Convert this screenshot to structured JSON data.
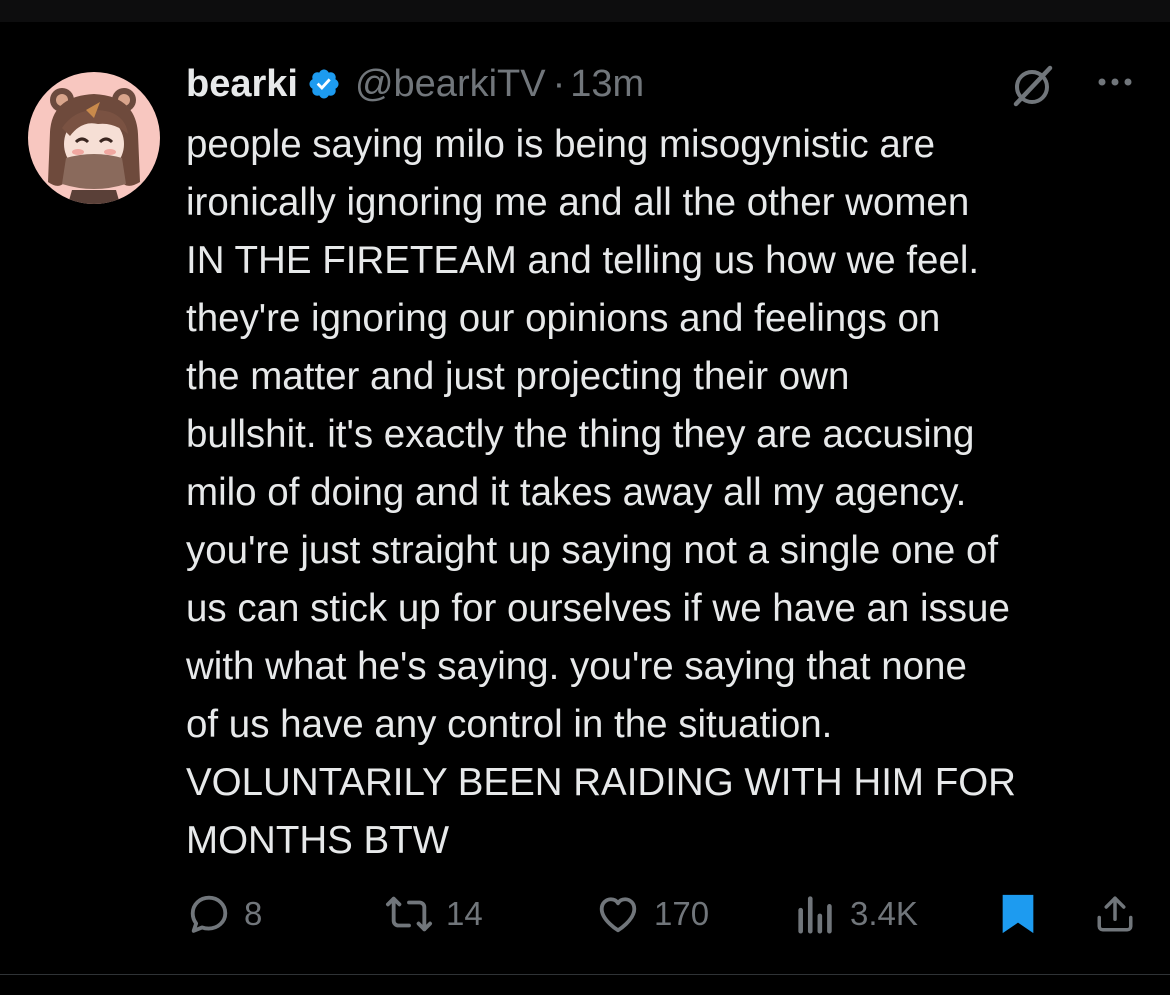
{
  "tweet": {
    "display_name": "bearki",
    "handle": "@bearkiTV",
    "separator": "·",
    "time": "13m",
    "verified": true,
    "text_lines": [
      "people saying milo is being misogynistic are",
      "ironically ignoring me and all the other women",
      "IN THE FIRETEAM and telling us how we feel.",
      "they're ignoring our opinions and feelings on",
      "the matter and just projecting their own",
      "bullshit. it's exactly the thing they are accusing",
      "milo of doing and it takes away all my agency.",
      "you're just straight up saying not a single one of",
      "us can stick up for ourselves if we have an issue",
      "with what he's saying. you're saying that none",
      "of us have any control in the situation.",
      "VOLUNTARILY BEEN RAIDING WITH HIM FOR",
      "MONTHS BTW"
    ]
  },
  "actions": {
    "replies": "8",
    "reposts": "14",
    "likes": "170",
    "views": "3.4K"
  },
  "icons": {
    "avatar": "avatar-image",
    "verified": "verified-badge-icon",
    "grok": "grok-icon",
    "more": "more-icon",
    "reply": "reply-icon",
    "repost": "repost-icon",
    "like": "heart-icon",
    "views": "views-icon",
    "bookmark": "bookmark-icon",
    "share": "share-icon"
  },
  "colors": {
    "background": "#000000",
    "text": "#e7e9ea",
    "muted": "#71767b",
    "accent": "#1d9bf0",
    "avatar_bg": "#f8c7c0"
  }
}
